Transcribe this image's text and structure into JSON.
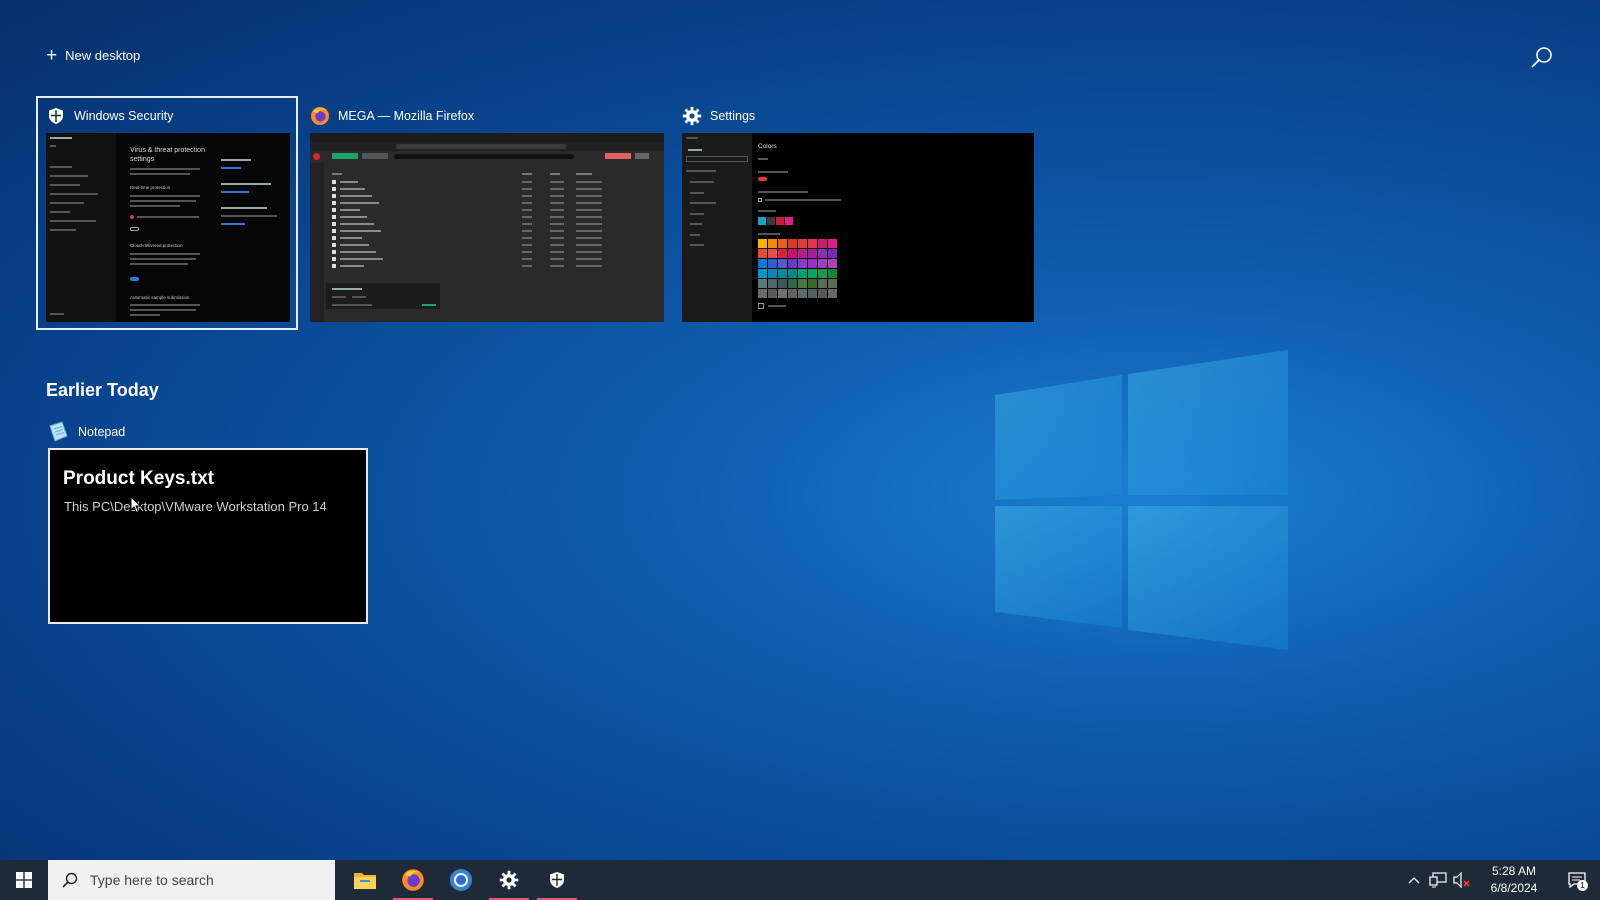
{
  "top": {
    "new_desktop_label": "New desktop"
  },
  "windows": [
    {
      "title": "Windows Security",
      "icon": "shield-icon",
      "selected": true
    },
    {
      "title": "MEGA — Mozilla Firefox",
      "icon": "firefox-icon"
    },
    {
      "title": "Settings",
      "icon": "gear-icon"
    }
  ],
  "security_preview": {
    "heading": "Virus & threat protection settings",
    "rtp": "Real-time protection",
    "cloud": "Cloud-delivered protection",
    "auto": "Automatic sample submission"
  },
  "settings_preview": {
    "heading": "Colors"
  },
  "timeline": {
    "section_title": "Earlier Today",
    "items": [
      {
        "app": "Notepad",
        "icon": "notepad-icon",
        "file": "Product Keys.txt",
        "path": "This PC\\Desktop\\VMware Workstation Pro 14"
      }
    ]
  },
  "taskbar": {
    "search_placeholder": "Type here to search",
    "time": "5:28 AM",
    "date": "6/8/2024",
    "notification_count": "1",
    "apps": [
      "file-explorer-icon",
      "firefox-icon",
      "chrome-icon",
      "gear-icon",
      "shield-icon"
    ]
  }
}
